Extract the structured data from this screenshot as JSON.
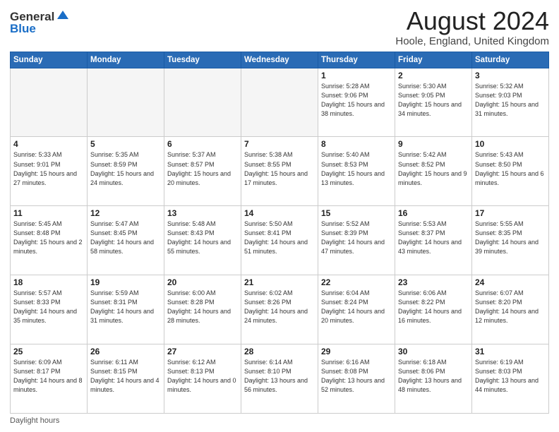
{
  "header": {
    "logo_general": "General",
    "logo_blue": "Blue",
    "month_title": "August 2024",
    "location": "Hoole, England, United Kingdom"
  },
  "calendar": {
    "days_of_week": [
      "Sunday",
      "Monday",
      "Tuesday",
      "Wednesday",
      "Thursday",
      "Friday",
      "Saturday"
    ],
    "weeks": [
      [
        {
          "day": "",
          "empty": true
        },
        {
          "day": "",
          "empty": true
        },
        {
          "day": "",
          "empty": true
        },
        {
          "day": "",
          "empty": true
        },
        {
          "day": "1",
          "sunrise": "Sunrise: 5:28 AM",
          "sunset": "Sunset: 9:06 PM",
          "daylight": "Daylight: 15 hours and 38 minutes."
        },
        {
          "day": "2",
          "sunrise": "Sunrise: 5:30 AM",
          "sunset": "Sunset: 9:05 PM",
          "daylight": "Daylight: 15 hours and 34 minutes."
        },
        {
          "day": "3",
          "sunrise": "Sunrise: 5:32 AM",
          "sunset": "Sunset: 9:03 PM",
          "daylight": "Daylight: 15 hours and 31 minutes."
        }
      ],
      [
        {
          "day": "4",
          "sunrise": "Sunrise: 5:33 AM",
          "sunset": "Sunset: 9:01 PM",
          "daylight": "Daylight: 15 hours and 27 minutes."
        },
        {
          "day": "5",
          "sunrise": "Sunrise: 5:35 AM",
          "sunset": "Sunset: 8:59 PM",
          "daylight": "Daylight: 15 hours and 24 minutes."
        },
        {
          "day": "6",
          "sunrise": "Sunrise: 5:37 AM",
          "sunset": "Sunset: 8:57 PM",
          "daylight": "Daylight: 15 hours and 20 minutes."
        },
        {
          "day": "7",
          "sunrise": "Sunrise: 5:38 AM",
          "sunset": "Sunset: 8:55 PM",
          "daylight": "Daylight: 15 hours and 17 minutes."
        },
        {
          "day": "8",
          "sunrise": "Sunrise: 5:40 AM",
          "sunset": "Sunset: 8:53 PM",
          "daylight": "Daylight: 15 hours and 13 minutes."
        },
        {
          "day": "9",
          "sunrise": "Sunrise: 5:42 AM",
          "sunset": "Sunset: 8:52 PM",
          "daylight": "Daylight: 15 hours and 9 minutes."
        },
        {
          "day": "10",
          "sunrise": "Sunrise: 5:43 AM",
          "sunset": "Sunset: 8:50 PM",
          "daylight": "Daylight: 15 hours and 6 minutes."
        }
      ],
      [
        {
          "day": "11",
          "sunrise": "Sunrise: 5:45 AM",
          "sunset": "Sunset: 8:48 PM",
          "daylight": "Daylight: 15 hours and 2 minutes."
        },
        {
          "day": "12",
          "sunrise": "Sunrise: 5:47 AM",
          "sunset": "Sunset: 8:45 PM",
          "daylight": "Daylight: 14 hours and 58 minutes."
        },
        {
          "day": "13",
          "sunrise": "Sunrise: 5:48 AM",
          "sunset": "Sunset: 8:43 PM",
          "daylight": "Daylight: 14 hours and 55 minutes."
        },
        {
          "day": "14",
          "sunrise": "Sunrise: 5:50 AM",
          "sunset": "Sunset: 8:41 PM",
          "daylight": "Daylight: 14 hours and 51 minutes."
        },
        {
          "day": "15",
          "sunrise": "Sunrise: 5:52 AM",
          "sunset": "Sunset: 8:39 PM",
          "daylight": "Daylight: 14 hours and 47 minutes."
        },
        {
          "day": "16",
          "sunrise": "Sunrise: 5:53 AM",
          "sunset": "Sunset: 8:37 PM",
          "daylight": "Daylight: 14 hours and 43 minutes."
        },
        {
          "day": "17",
          "sunrise": "Sunrise: 5:55 AM",
          "sunset": "Sunset: 8:35 PM",
          "daylight": "Daylight: 14 hours and 39 minutes."
        }
      ],
      [
        {
          "day": "18",
          "sunrise": "Sunrise: 5:57 AM",
          "sunset": "Sunset: 8:33 PM",
          "daylight": "Daylight: 14 hours and 35 minutes."
        },
        {
          "day": "19",
          "sunrise": "Sunrise: 5:59 AM",
          "sunset": "Sunset: 8:31 PM",
          "daylight": "Daylight: 14 hours and 31 minutes."
        },
        {
          "day": "20",
          "sunrise": "Sunrise: 6:00 AM",
          "sunset": "Sunset: 8:28 PM",
          "daylight": "Daylight: 14 hours and 28 minutes."
        },
        {
          "day": "21",
          "sunrise": "Sunrise: 6:02 AM",
          "sunset": "Sunset: 8:26 PM",
          "daylight": "Daylight: 14 hours and 24 minutes."
        },
        {
          "day": "22",
          "sunrise": "Sunrise: 6:04 AM",
          "sunset": "Sunset: 8:24 PM",
          "daylight": "Daylight: 14 hours and 20 minutes."
        },
        {
          "day": "23",
          "sunrise": "Sunrise: 6:06 AM",
          "sunset": "Sunset: 8:22 PM",
          "daylight": "Daylight: 14 hours and 16 minutes."
        },
        {
          "day": "24",
          "sunrise": "Sunrise: 6:07 AM",
          "sunset": "Sunset: 8:20 PM",
          "daylight": "Daylight: 14 hours and 12 minutes."
        }
      ],
      [
        {
          "day": "25",
          "sunrise": "Sunrise: 6:09 AM",
          "sunset": "Sunset: 8:17 PM",
          "daylight": "Daylight: 14 hours and 8 minutes."
        },
        {
          "day": "26",
          "sunrise": "Sunrise: 6:11 AM",
          "sunset": "Sunset: 8:15 PM",
          "daylight": "Daylight: 14 hours and 4 minutes."
        },
        {
          "day": "27",
          "sunrise": "Sunrise: 6:12 AM",
          "sunset": "Sunset: 8:13 PM",
          "daylight": "Daylight: 14 hours and 0 minutes."
        },
        {
          "day": "28",
          "sunrise": "Sunrise: 6:14 AM",
          "sunset": "Sunset: 8:10 PM",
          "daylight": "Daylight: 13 hours and 56 minutes."
        },
        {
          "day": "29",
          "sunrise": "Sunrise: 6:16 AM",
          "sunset": "Sunset: 8:08 PM",
          "daylight": "Daylight: 13 hours and 52 minutes."
        },
        {
          "day": "30",
          "sunrise": "Sunrise: 6:18 AM",
          "sunset": "Sunset: 8:06 PM",
          "daylight": "Daylight: 13 hours and 48 minutes."
        },
        {
          "day": "31",
          "sunrise": "Sunrise: 6:19 AM",
          "sunset": "Sunset: 8:03 PM",
          "daylight": "Daylight: 13 hours and 44 minutes."
        }
      ]
    ]
  },
  "footer": {
    "daylight_label": "Daylight hours"
  }
}
